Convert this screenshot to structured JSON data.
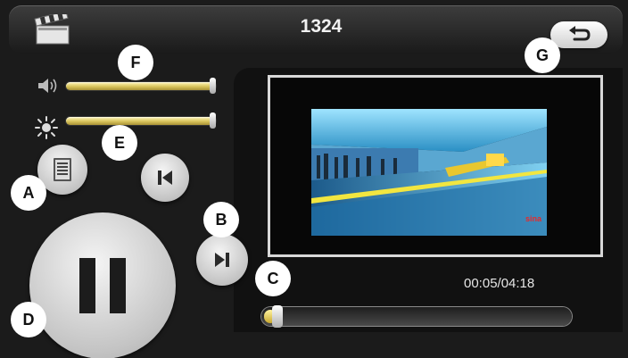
{
  "header": {
    "title": "1324",
    "left_icon": "clapperboard-icon",
    "back_icon": "back-arrow-icon"
  },
  "controls": {
    "volume_icon": "speaker-icon",
    "volume_level": 1.0,
    "brightness_icon": "sun-icon",
    "brightness_level": 1.0,
    "playlist_icon": "list-icon",
    "prev_icon": "skip-previous-icon",
    "pause_icon": "pause-icon",
    "next_icon": "skip-next-icon"
  },
  "playback": {
    "time": "00:05/04:18",
    "progress": 0.02
  },
  "watermark": "sina",
  "callouts": {
    "A": "A",
    "B": "B",
    "C": "C",
    "D": "D",
    "E": "E",
    "F": "F",
    "G": "G"
  },
  "colors": {
    "slider": "#d9c45c",
    "background": "#1b1b1b",
    "button": "#d0d0d0"
  }
}
